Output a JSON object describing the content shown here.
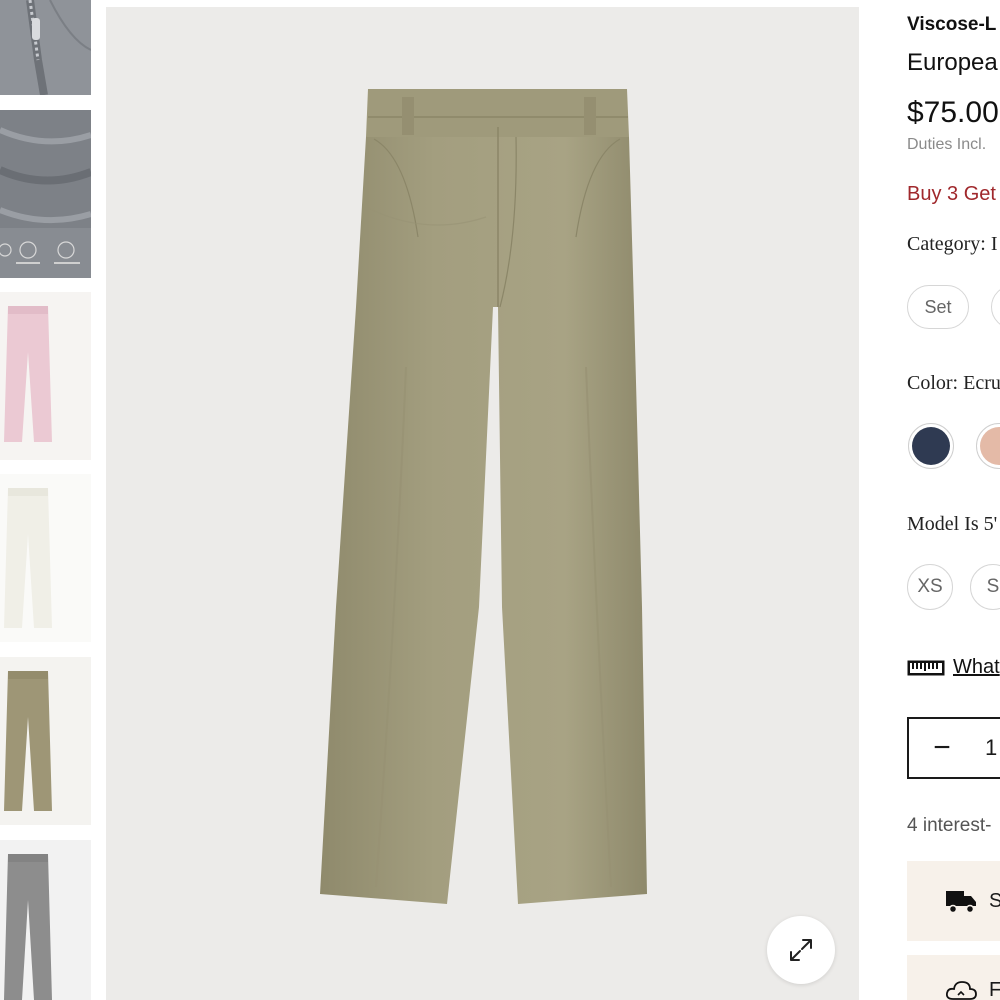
{
  "thumbnails": [
    {
      "name": "thumb-zipper-closeup",
      "color": "#8f9399"
    },
    {
      "name": "thumb-fabric-features",
      "color": "#7d8187"
    },
    {
      "name": "thumb-pink-pants",
      "color": "#ebc9d3"
    },
    {
      "name": "thumb-white-pants",
      "color": "#f2f1ea"
    },
    {
      "name": "thumb-olive-pants",
      "color": "#9e9676"
    },
    {
      "name": "thumb-gray-pants",
      "color": "#8d8d8d"
    }
  ],
  "product": {
    "title": "Viscose-L",
    "subtitle": "Europea",
    "price": "$75.00",
    "duties": "Duties Incl.",
    "promo": "Buy 3 Get",
    "pants_color": "#a39e7f"
  },
  "options": {
    "category_label": "Category: I",
    "category_pills": [
      "Set",
      ""
    ],
    "color_label": "Color: Ecru",
    "swatches": [
      {
        "name": "navy",
        "hex": "#2f3a52"
      },
      {
        "name": "blush",
        "hex": "#e4baa7"
      }
    ],
    "model_label": "Model Is 5'",
    "sizes": [
      "XS",
      "S"
    ]
  },
  "size_guide": {
    "icon": "ruler-icon",
    "label": "What"
  },
  "quantity": {
    "minus": "−",
    "value": "1"
  },
  "installments": "4 interest-",
  "shipping": {
    "icon": "truck-icon",
    "label": "S"
  },
  "returns": {
    "icon": "cloud-icon",
    "label": "F"
  },
  "zoom": {
    "icon": "expand-icon"
  }
}
